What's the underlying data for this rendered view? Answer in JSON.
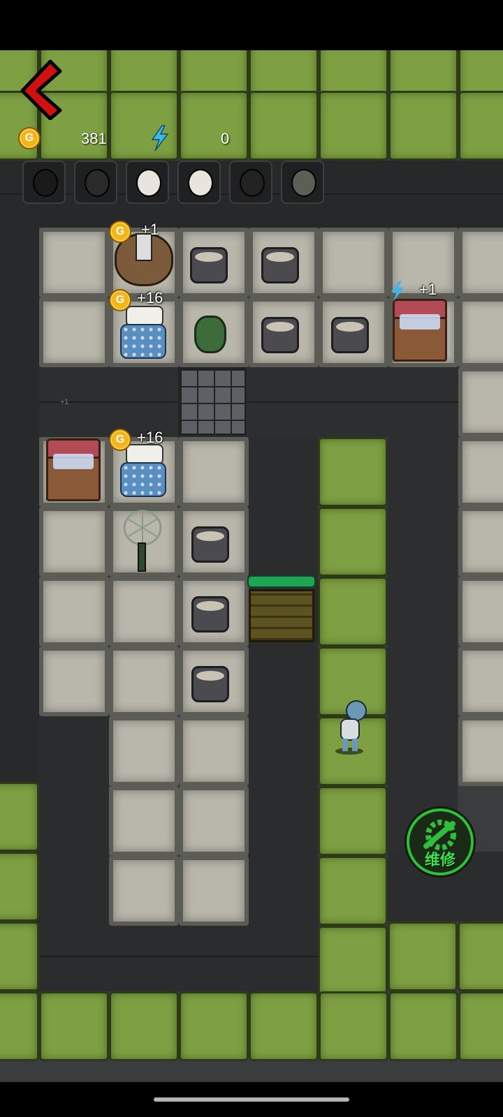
{
  "hud": {
    "coin_label": "G",
    "coins": "381",
    "energy": "0",
    "back_icon": "chevron-left-icon",
    "energy_icon": "lightning-icon"
  },
  "character_slots": [
    {
      "name": "ghost-slot-black-hair"
    },
    {
      "name": "ghost-slot-messy-hair"
    },
    {
      "name": "ghost-slot-granny"
    },
    {
      "name": "ghost-slot-granny-2"
    },
    {
      "name": "ghost-slot-topknot"
    },
    {
      "name": "ghost-slot-green-mask"
    }
  ],
  "board": {
    "gains": {
      "coffin": "+1",
      "bed_top": "+16",
      "chest_top": "+1",
      "bed_left": "+16",
      "wall_energy": "+1"
    },
    "door_health": 1.0,
    "repair_button": "维修"
  },
  "colors": {
    "grass": "#7ea043",
    "floor": "#b9b6ab",
    "wall": "#2e2f31",
    "door_health": "#1fa355",
    "repair_green": "#2fbf3c"
  }
}
